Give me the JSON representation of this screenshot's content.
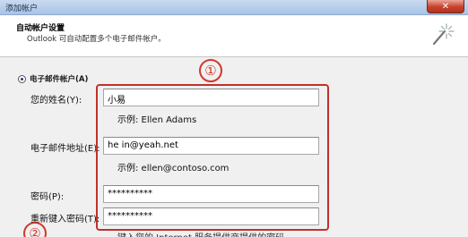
{
  "window": {
    "title": "添加帐户",
    "close_glyph": "✕"
  },
  "header": {
    "title": "自动帐户设置",
    "subtitle": "Outlook 可自动配置多个电子邮件帐户。"
  },
  "account_type": {
    "label": "电子邮件帐户(A)",
    "selected": true
  },
  "form": {
    "name": {
      "label": "您的姓名(Y):",
      "value": "小易",
      "example": "示例: Ellen Adams"
    },
    "email": {
      "label": "电子邮件地址(E):",
      "value": "he      in@yeah.net",
      "example": "示例: ellen@contoso.com"
    },
    "password": {
      "label": "密码(P):",
      "value": "**********"
    },
    "password_confirm": {
      "label": "重新键入密码(T):",
      "value": "**********"
    },
    "hint": "键入您的 Internet 服务提供商提供的密码。"
  },
  "annotations": {
    "marker_1": "①",
    "marker_2": "②",
    "color": "#c0312b"
  }
}
